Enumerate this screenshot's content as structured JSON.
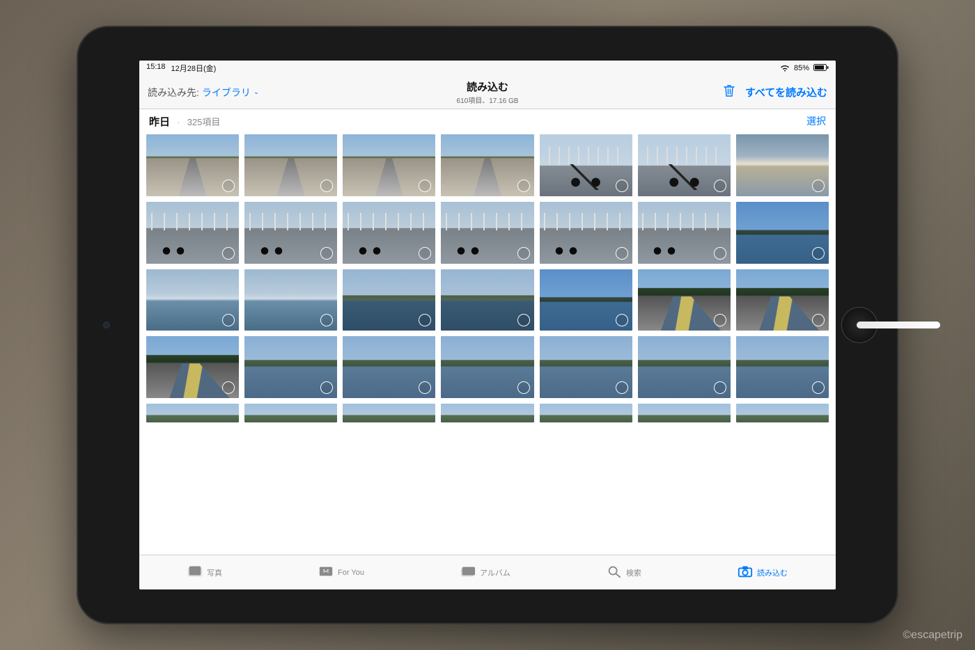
{
  "watermark": "©escapetrip",
  "status": {
    "time": "15:18",
    "date": "12月28日(金)",
    "battery_pct": "85%"
  },
  "header": {
    "dest_label": "読み込み先:",
    "dest_value": "ライブラリ",
    "title": "読み込む",
    "subtitle": "610項目、17.16 GB",
    "import_all": "すべてを読み込む"
  },
  "section": {
    "day": "昨日",
    "count": "325項目",
    "select": "選択"
  },
  "thumbs": {
    "rows": [
      [
        "p-road",
        "p-road",
        "p-road",
        "p-road",
        "p-bike",
        "p-bike",
        "p-sea-sun"
      ],
      [
        "p-bridge",
        "p-bridge",
        "p-bridge",
        "p-bridge",
        "p-bridge",
        "p-bridge",
        "p-island"
      ],
      [
        "p-sea",
        "p-sea",
        "p-bay",
        "p-bay",
        "p-island",
        "p-cycleroad",
        "p-cycleroad"
      ],
      [
        "p-cycleroad",
        "p-river",
        "p-river",
        "p-river",
        "p-river",
        "p-river",
        "p-river"
      ]
    ],
    "partial_row": [
      "p-partial",
      "p-partial",
      "p-partial",
      "p-partial",
      "p-partial",
      "p-partial",
      "p-partial"
    ]
  },
  "tabs": [
    {
      "id": "photos",
      "label": "写真",
      "active": false
    },
    {
      "id": "foryou",
      "label": "For You",
      "active": false
    },
    {
      "id": "albums",
      "label": "アルバム",
      "active": false
    },
    {
      "id": "search",
      "label": "検索",
      "active": false
    },
    {
      "id": "import",
      "label": "読み込む",
      "active": true
    }
  ]
}
